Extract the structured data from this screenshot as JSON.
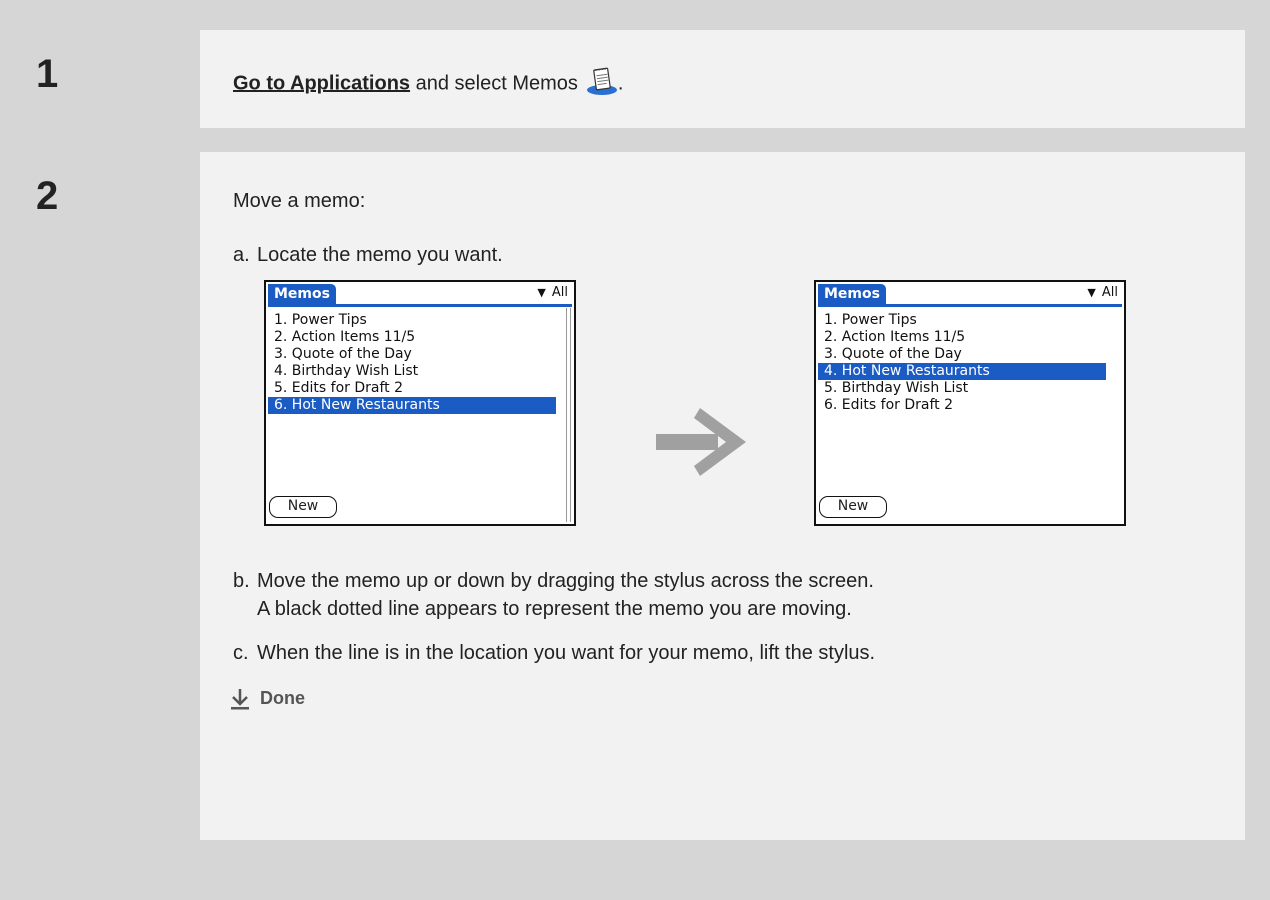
{
  "step1": {
    "number": "1",
    "link_text": "Go to Applications",
    "text_after": " and select Memos",
    "period": ".",
    "icon": "memos-notepad-icon"
  },
  "step2": {
    "number": "2",
    "intro": "Move a memo:",
    "a": {
      "label": "a.",
      "text": "Locate the memo you want."
    },
    "b": {
      "label": "b.",
      "text_line1": "Move the memo up or down by dragging the stylus across the screen.",
      "text_line2": "A black dotted line appears to represent the memo you are moving."
    },
    "c": {
      "label": "c.",
      "text": "When the line is in the location you want for your memo, lift the stylus."
    },
    "done": "Done"
  },
  "screens": {
    "before": {
      "title": "Memos",
      "category": "All",
      "items": [
        "1. Power Tips",
        "2. Action Items 11/5",
        "3. Quote of the Day",
        "4. Birthday Wish List",
        "5. Edits for Draft 2",
        "6. Hot New Restaurants"
      ],
      "selected_index": 5,
      "new_button": "New"
    },
    "after": {
      "title": "Memos",
      "category": "All",
      "items": [
        "1. Power Tips",
        "2. Action Items 11/5",
        "3. Quote of the Day",
        "4. Hot New Restaurants",
        "5. Birthday Wish List",
        "6. Edits for Draft 2"
      ],
      "selected_index": 3,
      "new_button": "New"
    }
  },
  "colors": {
    "panel": "#d6d6d6",
    "content": "#f2f2f2",
    "highlight": "#1a5bc4",
    "arrow": "#a0a0a0"
  }
}
